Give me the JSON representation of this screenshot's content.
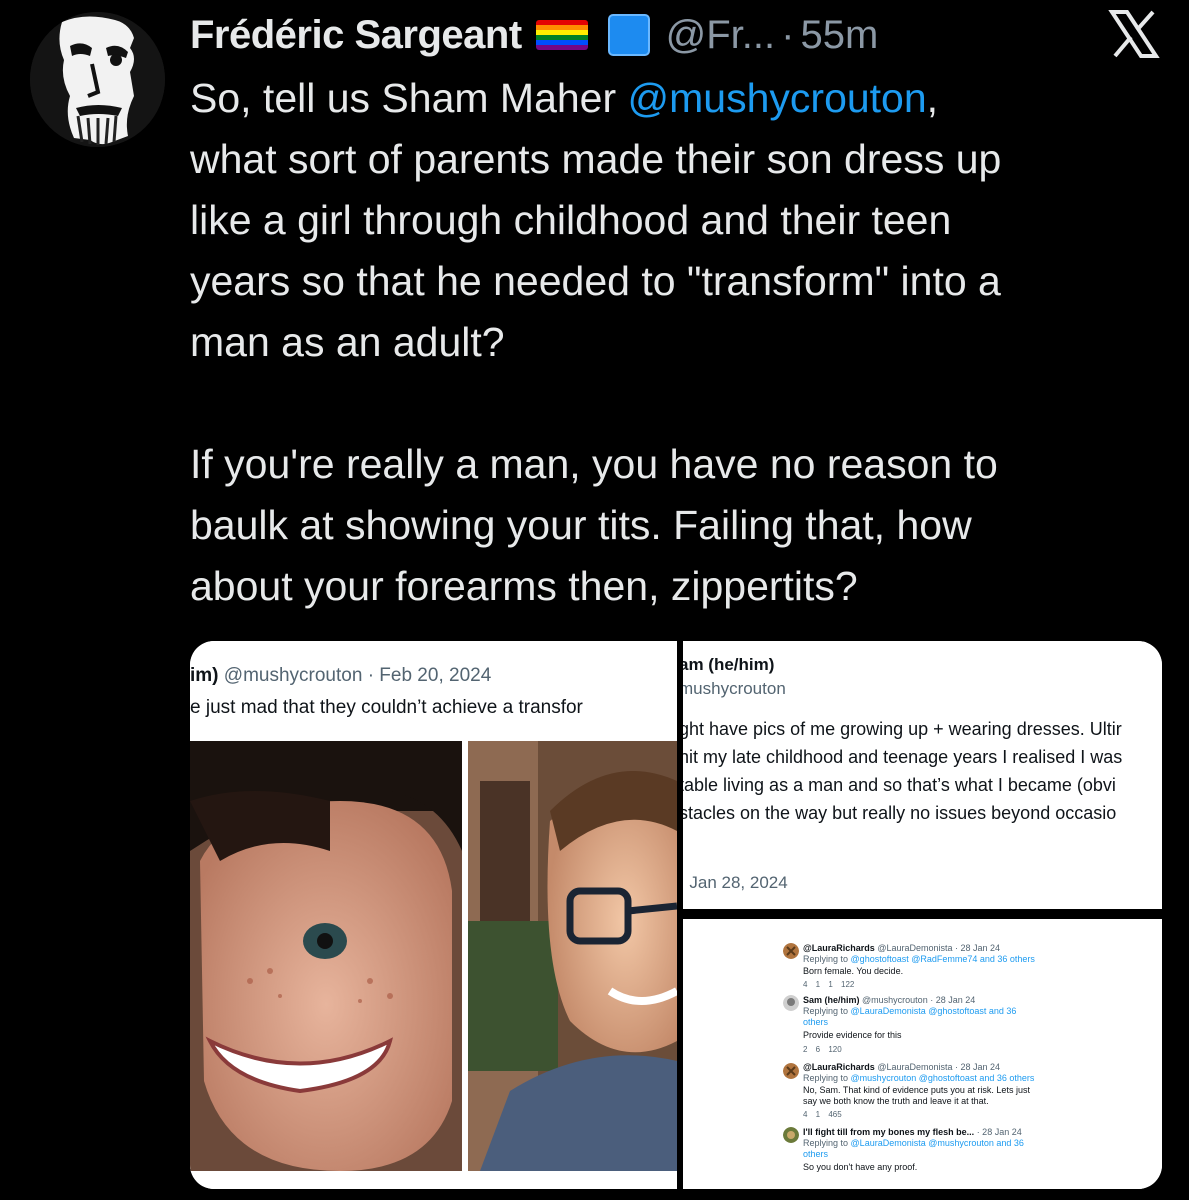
{
  "author": {
    "name": "Frédéric Sargeant",
    "handle": "@Fr...",
    "separator": "·",
    "time": "55m"
  },
  "icons": {
    "flag": "rainbow-flag-icon",
    "square": "blue-square-icon",
    "logo": "x-logo-icon"
  },
  "tweet": {
    "lines": [
      {
        "before": "So, tell us Sham Maher ",
        "mention": "@mushycrouton",
        "after": ","
      },
      {
        "text": "what sort of parents made their son dress up"
      },
      {
        "text": "like a girl through childhood and their teen"
      },
      {
        "text": "years so that he needed to \"transform\" into a"
      },
      {
        "text": "man as an adult?"
      },
      {
        "text": ""
      },
      {
        "text": "If you're really a man, you have no reason to"
      },
      {
        "text": "baulk at showing your tits.  Failing that, how"
      },
      {
        "text": "about your forearms then, zippertits?"
      }
    ]
  },
  "screenshot1": {
    "name_fragment": "im)",
    "handle": "@mushycrouton",
    "date": "· Feb 20, 2024",
    "text": "e just mad that they couldn’t achieve a transfor"
  },
  "screenshot2": {
    "name_fragment": "am (he/him)",
    "handle": "mushycrouton",
    "body": [
      "ght have pics of me growing up + wearing dresses. Ultir",
      "hit my late childhood and teenage years I realised I was",
      "table living as a man and so that’s what I became (obvi",
      "stacles on the way but really no issues beyond occasio"
    ],
    "date": "· Jan 28, 2024"
  },
  "screenshot3": {
    "replies": [
      {
        "name": "@LauraRichards",
        "meta": "@LauraDemonista · 28 Jan 24",
        "replying": "Replying to",
        "replying_to": "@ghostoftoast @RadFemme74 and 36 others",
        "text": "Born female. You decide.",
        "metrics": "4  1  1  122"
      },
      {
        "name": "Sam (he/him)",
        "meta": "@mushycrouton · 28 Jan 24",
        "replying": "Replying to",
        "replying_to": "@LauraDemonista @ghostoftoast and 36",
        "replying_to_2": "others",
        "text": "Provide evidence for this",
        "metrics": "2  6  120"
      },
      {
        "name": "@LauraRichards",
        "meta": "@LauraDemonista · 28 Jan 24",
        "replying": "Replying to",
        "replying_to": "@mushycrouton @ghostoftoast and 36 others",
        "text": "No, Sam. That kind of evidence puts you at risk. Lets just",
        "text_2": "say we both know the truth and leave it at that.",
        "metrics": "4  1  465"
      },
      {
        "name": "I'll fight till from my bones my flesh be...",
        "meta": "· 28 Jan 24",
        "replying": "Replying to",
        "replying_to": "@LauraDemonista @mushycrouton and 36",
        "replying_to_2": "others",
        "text": "So you don't have any proof."
      }
    ]
  },
  "colors": {
    "background": "#000000",
    "text": "#e7e9ea",
    "secondary": "#8b98a5",
    "link": "#1d9bf0"
  }
}
